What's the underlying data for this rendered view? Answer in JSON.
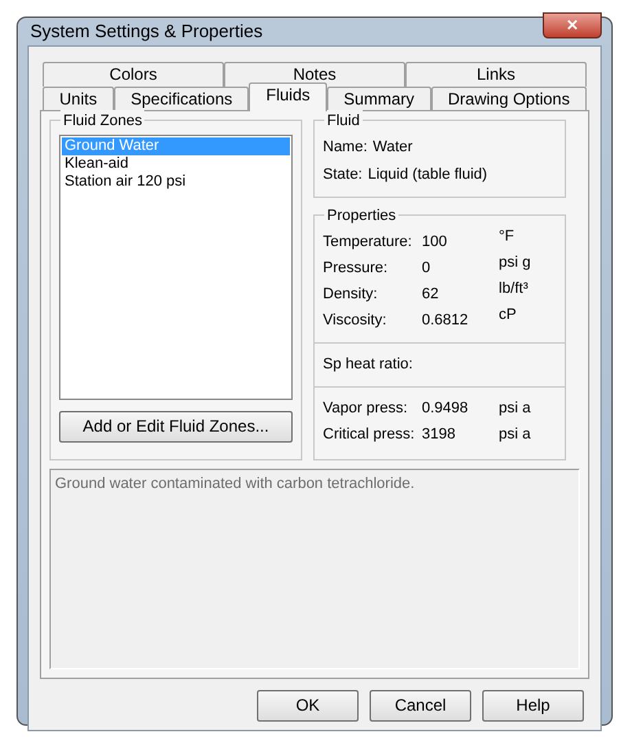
{
  "window": {
    "title": "System Settings & Properties",
    "close": "✕"
  },
  "tab_rows": [
    [
      {
        "label": "Colors",
        "selected": false
      },
      {
        "label": "Notes",
        "selected": false
      },
      {
        "label": "Links",
        "selected": false
      }
    ],
    [
      {
        "label": "Units",
        "selected": false
      },
      {
        "label": "Specifications",
        "selected": false
      },
      {
        "label": "Fluids",
        "selected": true
      },
      {
        "label": "Summary",
        "selected": false
      },
      {
        "label": "Drawing Options",
        "selected": false
      }
    ]
  ],
  "fluid_zones": {
    "title": "Fluid Zones",
    "items": [
      {
        "label": "Ground Water",
        "selected": true
      },
      {
        "label": "Klean-aid",
        "selected": false
      },
      {
        "label": "Station air 120 psi",
        "selected": false
      }
    ],
    "button": "Add or Edit Fluid Zones..."
  },
  "fluid": {
    "title": "Fluid",
    "rows": [
      {
        "label": "Name:",
        "value": "Water"
      },
      {
        "label": "State:",
        "value": "Liquid (table fluid)"
      }
    ]
  },
  "properties": {
    "title": "Properties",
    "sections": [
      [
        {
          "label": "Temperature:",
          "value": "100",
          "unit": "°F"
        },
        {
          "label": "Pressure:",
          "value": "0",
          "unit": "psi g"
        },
        {
          "label": "Density:",
          "value": "62",
          "unit": "lb/ft³"
        },
        {
          "label": "Viscosity:",
          "value": "0.6812",
          "unit": "cP"
        }
      ],
      [
        {
          "label": "Sp heat ratio:"
        }
      ],
      [
        {
          "label": "Vapor press:",
          "value": "0.9498",
          "unit": "psi a"
        },
        {
          "label": "Critical press:",
          "value": "3198",
          "unit": "psi a"
        }
      ]
    ]
  },
  "description": "Ground water contaminated with carbon tetrachloride.",
  "buttons": [
    "OK",
    "Cancel",
    "Help"
  ]
}
